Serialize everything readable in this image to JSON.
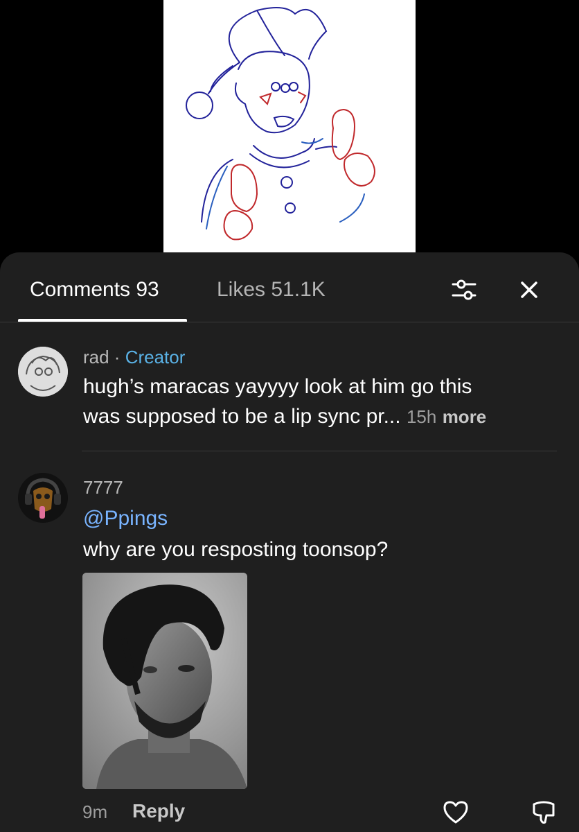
{
  "tabs": {
    "comments_label": "Comments 93",
    "likes_label": "Likes 51.1K"
  },
  "icons": {
    "filter": "sliders-icon",
    "close": "close-icon",
    "like": "heart-icon",
    "dislike": "dislike-icon"
  },
  "colors": {
    "sheet_bg": "#1f1f1f",
    "creator_accent": "#5ab2e6",
    "mention": "#79b4ff"
  },
  "comments": [
    {
      "username": "rad",
      "separator": " · ",
      "badge": "Creator",
      "line1": "hugh’s maracas yayyyy look at him go this",
      "line2": "was supposed to be a lip sync pr...",
      "time": "15h",
      "more": "more"
    },
    {
      "username": "7777",
      "mention": "@Ppings",
      "text": "why are you resposting toonsop?",
      "time": "9m",
      "reply": "Reply"
    }
  ]
}
